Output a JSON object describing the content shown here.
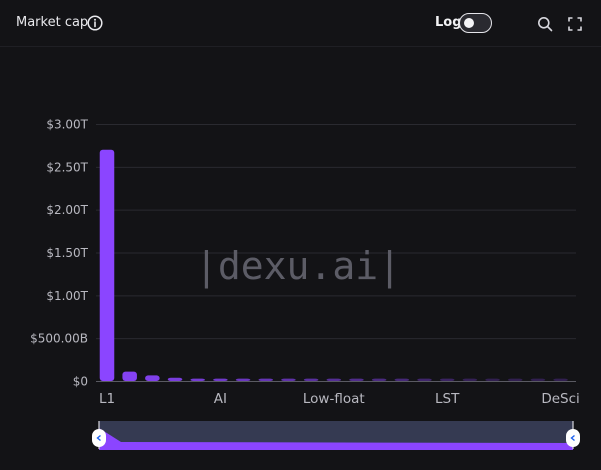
{
  "header": {
    "title": "Market cap",
    "log_label": "Log",
    "log_enabled": false,
    "icons": [
      "info-icon",
      "search-icon",
      "expand-icon"
    ]
  },
  "watermark": "|dexu.ai|",
  "colors": {
    "background": "#131316",
    "bar": "#8b45ff",
    "grid": "#2a2a30",
    "axis_text": "#b8b8c0",
    "slider_fill": "#353a52"
  },
  "chart_data": {
    "type": "bar",
    "ylabel_ticks": [
      "$0",
      "$500.00B",
      "$1.00T",
      "$1.50T",
      "$2.00T",
      "$2.50T",
      "$3.00T"
    ],
    "ylim": [
      0,
      3000
    ],
    "unit": "billions USD",
    "x_tick_labels": [
      "L1",
      "AI",
      "Low-float",
      "LST",
      "DeSci"
    ],
    "x_tick_category_index": [
      0,
      5,
      10,
      15,
      20
    ],
    "values": [
      2700,
      110,
      65,
      38,
      28,
      20,
      17,
      15,
      13,
      12,
      11,
      10,
      9,
      8,
      7,
      6,
      6,
      5,
      5,
      4,
      4
    ],
    "grid": true
  },
  "slider": {
    "start": 0,
    "end": 1
  }
}
